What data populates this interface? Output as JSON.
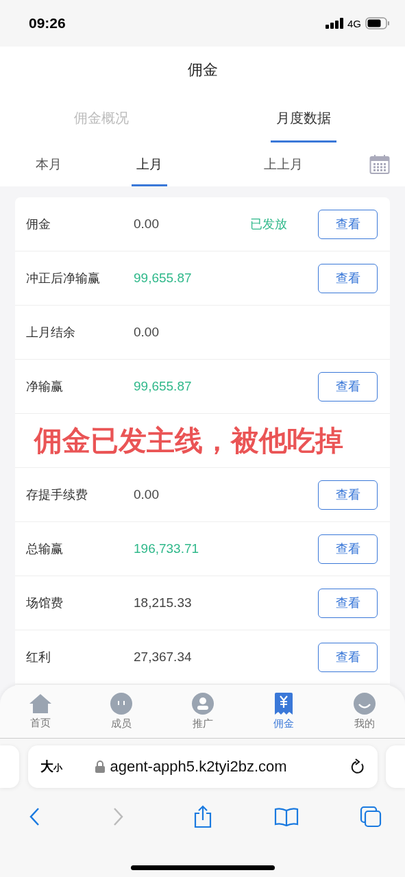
{
  "status_bar": {
    "time": "09:26",
    "network": "4G"
  },
  "header": {
    "title": "佣金"
  },
  "tabs": [
    {
      "label": "佣金概况",
      "selected": false
    },
    {
      "label": "月度数据",
      "selected": true
    }
  ],
  "periods": [
    {
      "label": "本月",
      "selected": false
    },
    {
      "label": "上月",
      "selected": true
    },
    {
      "label": "上上月",
      "selected": false
    }
  ],
  "rows": [
    {
      "label": "佣金",
      "value": "0.00",
      "highlight": false,
      "status": "已发放",
      "action": "查看"
    },
    {
      "label": "冲正后净输赢",
      "value": "99,655.87",
      "highlight": true,
      "action": "查看"
    },
    {
      "label": "上月结余",
      "value": "0.00",
      "highlight": false
    },
    {
      "label": "净输赢",
      "value": "99,655.87",
      "highlight": true,
      "action": "查看"
    },
    {
      "kind": "covered",
      "annotation": "佣金已发主线，被他吃掉"
    },
    {
      "label": "存提手续费",
      "value": "0.00",
      "highlight": false,
      "action": "查看"
    },
    {
      "label": "总输赢",
      "value": "196,733.71",
      "highlight": true,
      "action": "查看"
    },
    {
      "label": "场馆费",
      "value": "18,215.33",
      "highlight": false,
      "action": "查看"
    },
    {
      "label": "红利",
      "value": "27,367.34",
      "highlight": false,
      "action": "查看"
    }
  ],
  "bottom_nav": [
    {
      "label": "首页",
      "kind": "home",
      "selected": false
    },
    {
      "label": "成员",
      "kind": "members",
      "selected": false
    },
    {
      "label": "推广",
      "kind": "person",
      "selected": false
    },
    {
      "label": "佣金",
      "kind": "yen",
      "selected": true
    },
    {
      "label": "我的",
      "kind": "smile",
      "selected": false
    }
  ],
  "browser": {
    "text_size": "大",
    "text_size_small": "小",
    "url": "agent-apph5.k2tyi2bz.com"
  }
}
